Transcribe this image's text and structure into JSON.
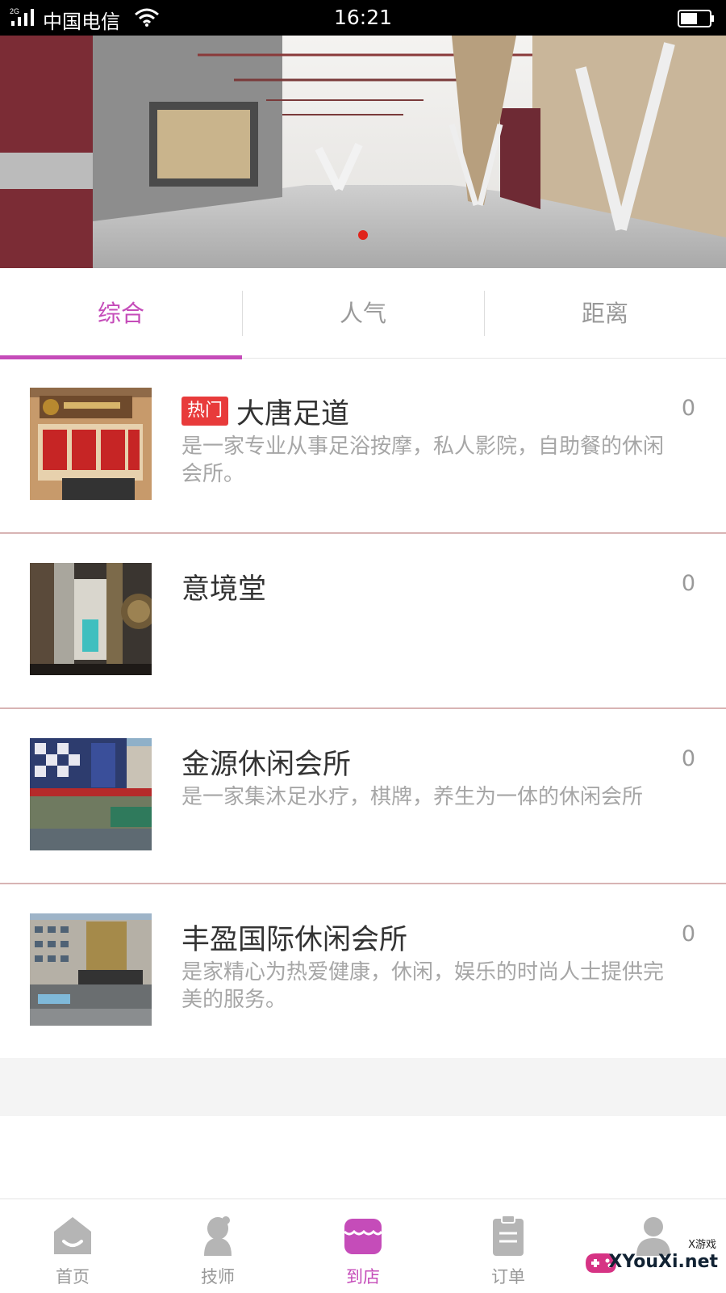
{
  "status_bar": {
    "network": "2G",
    "carrier": "中国电信",
    "time": "16:21"
  },
  "banner": {
    "slide_count": 1,
    "active_slide": 0,
    "indicator_color": "#e0241b"
  },
  "tabs": [
    {
      "label": "综合",
      "active": true
    },
    {
      "label": "人气",
      "active": false
    },
    {
      "label": "距离",
      "active": false
    }
  ],
  "stores": [
    {
      "badge": "热门",
      "name": "大唐足道",
      "count": "0",
      "description": "是一家专业从事足浴按摩，私人影院，自助餐的休闲会所。"
    },
    {
      "badge": "",
      "name": "意境堂",
      "count": "0",
      "description": ""
    },
    {
      "badge": "",
      "name": "金源休闲会所",
      "count": "0",
      "description": "是一家集沐足水疗，棋牌，养生为一体的休闲会所"
    },
    {
      "badge": "",
      "name": "丰盈国际休闲会所",
      "count": "0",
      "description": "是家精心为热爱健康，休闲，娱乐的时尚人士提供完美的服务。"
    }
  ],
  "bottom_nav": [
    {
      "label": "首页",
      "icon": "home-icon",
      "active": false
    },
    {
      "label": "技师",
      "icon": "technician-icon",
      "active": false
    },
    {
      "label": "到店",
      "icon": "store-icon",
      "active": true
    },
    {
      "label": "订单",
      "icon": "clipboard-icon",
      "active": false
    },
    {
      "label": "",
      "icon": "user-icon",
      "active": false
    }
  ],
  "watermark": {
    "small": "X游戏",
    "text": "XYouXi.net"
  },
  "colors": {
    "accent": "#c54cb9",
    "hot_badge": "#e83b3b",
    "divider": "#d8b4b4"
  }
}
